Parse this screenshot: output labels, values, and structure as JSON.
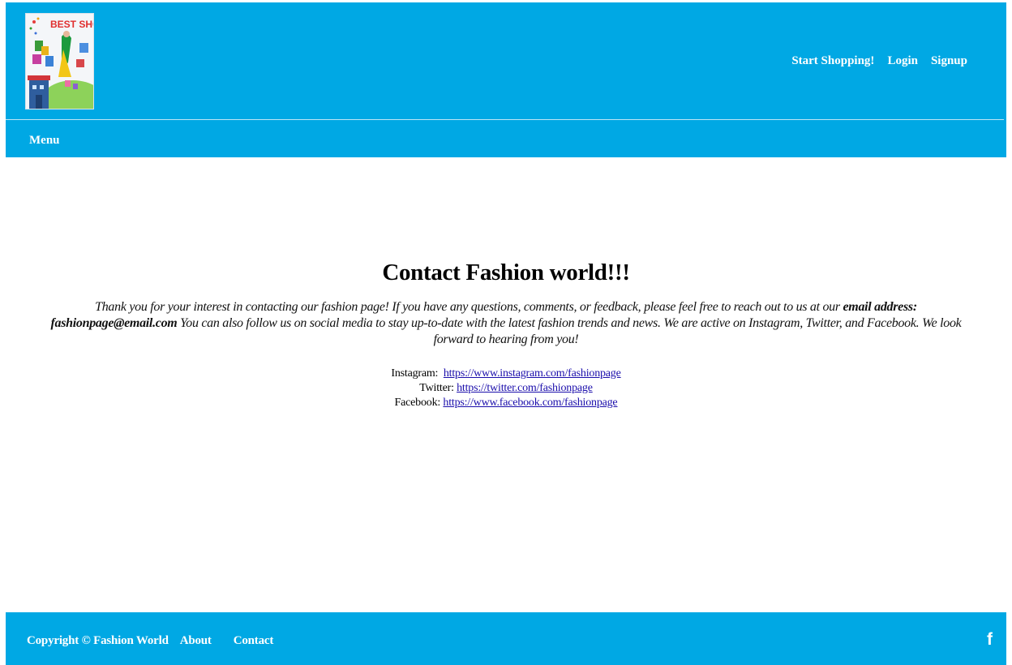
{
  "header": {
    "logo_text": "BEST SHOPPING",
    "nav": {
      "start_shopping": "Start Shopping!",
      "login": "Login",
      "signup": "Signup"
    },
    "menu_label": "Menu",
    "background": "#00a8e4"
  },
  "main": {
    "title": "Contact Fashion world!!!",
    "intro_start": "Thank you for your interest in contacting our fashion page! If you have any questions, comments, or feedback, please feel free to reach out to us at our",
    "intro_email_label": "email address:",
    "intro_email": "fashionpage@email.com",
    "intro_end": "You can also follow us on social media to stay up-to-date with the latest fashion trends and news. We are active on Instagram, Twitter, and Facebook. We look forward to hearing from you!",
    "socials": [
      {
        "label": "Instagram:",
        "url": "https://www.instagram.com/fashionpage"
      },
      {
        "label": "Twitter:",
        "url": "https://twitter.com/fashionpage"
      },
      {
        "label": "Facebook:",
        "url": "https://www.facebook.com/fashionpage"
      }
    ]
  },
  "footer": {
    "copyright": "Copyright © Fashion World",
    "about": "About",
    "contact": "Contact",
    "facebook_icon_glyph": "f",
    "facebook_icon": "facebook-icon"
  }
}
